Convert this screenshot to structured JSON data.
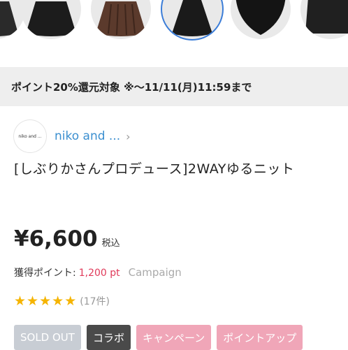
{
  "thumbnails": [
    {
      "name": "thumb-1",
      "color": "#2a2a2a"
    },
    {
      "name": "thumb-2",
      "color": "#1c1c1c"
    },
    {
      "name": "thumb-3",
      "color": "#5b3a2c"
    },
    {
      "name": "thumb-4",
      "color": "#1a1a1a",
      "selected": true
    },
    {
      "name": "thumb-5",
      "color": "#141414"
    },
    {
      "name": "thumb-6",
      "color": "#202020"
    }
  ],
  "banner": {
    "text": "ポイント20%還元対象 ※～11/11(月)11:59まで"
  },
  "brand": {
    "logo_text": "niko and ...",
    "name": "niko and ...",
    "chevron": "›"
  },
  "product": {
    "title": "[しぶりかさんプロデュース]2WAYゆるニット",
    "price": "¥6,600",
    "tax_label": "税込"
  },
  "points": {
    "label": "獲得ポイント:",
    "value": "1,200 pt",
    "campaign_label": "Campaign"
  },
  "rating": {
    "stars": 5,
    "star_glyph": "★",
    "count_text": "(17件)"
  },
  "tags": [
    {
      "label": "SOLD OUT",
      "color": "#c8cdd4"
    },
    {
      "label": "コラボ",
      "color": "#4a4a4a"
    },
    {
      "label": "キャンペーン",
      "color": "#f0a6b8"
    },
    {
      "label": "ポイントアップ",
      "color": "#f0a6b8"
    }
  ],
  "colors": {
    "accent_link": "#3b8fd0",
    "points_red": "#e03a5a",
    "star": "#f5b400"
  }
}
